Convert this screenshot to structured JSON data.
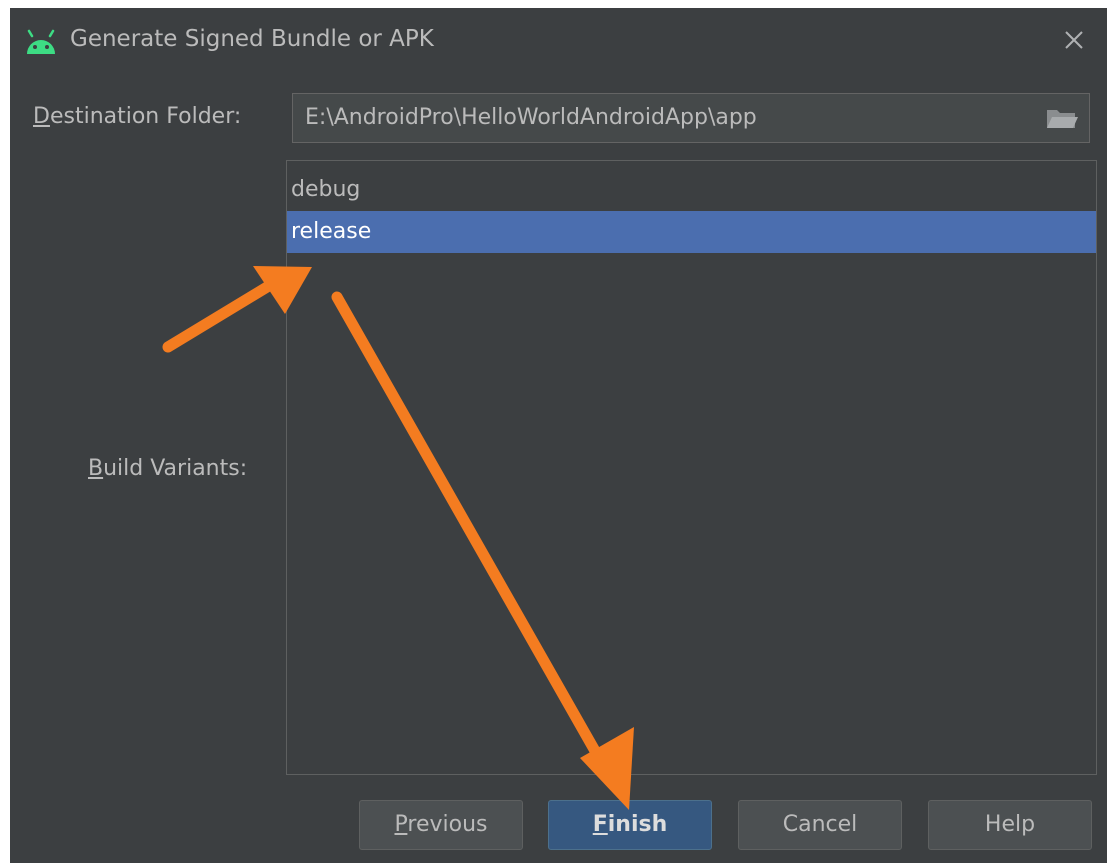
{
  "window": {
    "title": "Generate Signed Bundle or APK",
    "icon": "android-icon",
    "close_icon": "close-icon"
  },
  "destination": {
    "label_mnemonic": "D",
    "label_rest": "estination Folder:",
    "value": "E:\\AndroidPro\\HelloWorldAndroidApp\\app",
    "browse_icon": "folder-icon"
  },
  "build_variants": {
    "label_mnemonic": "B",
    "label_rest": "uild Variants:",
    "items": [
      {
        "label": "debug",
        "selected": false
      },
      {
        "label": "release",
        "selected": true
      }
    ]
  },
  "buttons": {
    "previous_mnemonic": "P",
    "previous_rest": "revious",
    "finish_mnemonic": "F",
    "finish_rest": "inish",
    "cancel": "Cancel",
    "help": "Help"
  },
  "colors": {
    "dialog_bg": "#3c3f41",
    "selection": "#4b6eaf",
    "default_button": "#365880",
    "annotation_arrow": "#f47c20",
    "android_green": "#3ddc84"
  }
}
